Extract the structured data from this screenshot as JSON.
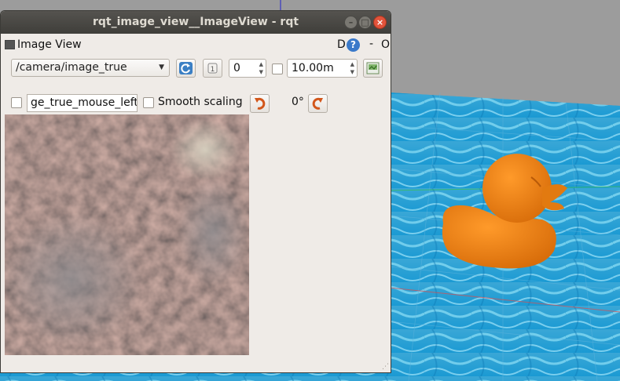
{
  "window": {
    "title": "rqt_image_view__ImageView - rqt",
    "minimize_glyph": "–",
    "maximize_glyph": "□",
    "close_glyph": "×"
  },
  "dock": {
    "title": "Image View",
    "d_label": "D",
    "help_glyph": "?",
    "dash_label": "-",
    "o_label": "O"
  },
  "toolbar": {
    "topic_selected": "/camera/image_true",
    "frame_count": "0",
    "duration": "10.00m",
    "mouse_topic": "ge_true_mouse_left",
    "smooth_scaling_label": "Smooth scaling",
    "rotation": "0°"
  },
  "icons": {
    "refresh": "refresh-icon",
    "zero": "zero-icon",
    "save": "save-icon",
    "rotate_left": "rotate-left-icon",
    "rotate_right": "rotate-right-icon"
  },
  "colors": {
    "titlebar": "#3f3e3a",
    "window_bg": "#efebe7",
    "close": "#e2533b",
    "duck": "#f08214",
    "water": "#2ba6d8"
  }
}
